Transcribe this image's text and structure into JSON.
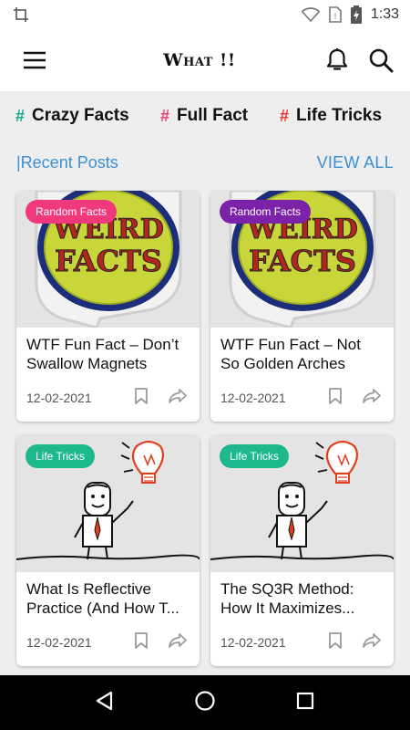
{
  "status_bar": {
    "time": "1:33"
  },
  "app_bar": {
    "title": "What !!"
  },
  "tags": [
    {
      "label": "Crazy Facts",
      "color": "#1aa58a"
    },
    {
      "label": "Full Fact",
      "color": "#e53d7a"
    },
    {
      "label": "Life Tricks",
      "color": "#e53935"
    }
  ],
  "section": {
    "title": "|Recent Posts",
    "view_all": "VIEW ALL"
  },
  "posts": [
    {
      "badge": "Random Facts",
      "badge_color": "#f0387c",
      "image": "weird-facts-image",
      "title": "WTF Fun Fact – Don’t Swallow Magnets",
      "date": "12-02-2021"
    },
    {
      "badge": "Random Facts",
      "badge_color": "#7b22a8",
      "image": "weird-facts-image",
      "title": "WTF Fun Fact – Not So Golden Arches",
      "date": "12-02-2021"
    },
    {
      "badge": "Life Tricks",
      "badge_color": "#1eb88e",
      "image": "lightbulb-idea-image",
      "title": "What Is Reflective Practice (And How T...",
      "date": "12-02-2021"
    },
    {
      "badge": "Life Tricks",
      "badge_color": "#1eb88e",
      "image": "lightbulb-idea-image",
      "title": "The SQ3R Method: How It Maximizes...",
      "date": "12-02-2021"
    }
  ],
  "icons": {
    "menu": "hamburger-menu-icon",
    "notifications": "bell-icon",
    "search": "search-icon",
    "bookmark": "bookmark-icon",
    "share": "share-icon",
    "back": "back-triangle-icon",
    "home": "home-circle-icon",
    "recents": "recents-square-icon"
  }
}
